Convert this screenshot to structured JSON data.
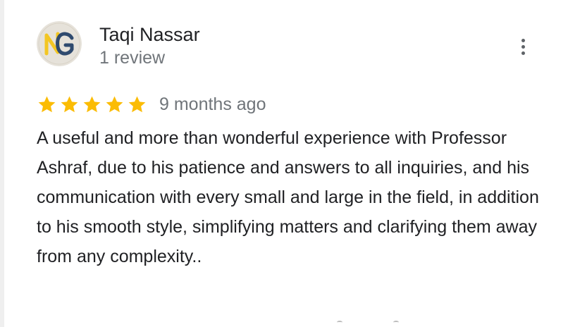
{
  "review": {
    "reviewer_name": "Taqi Nassar",
    "review_count": "1 review",
    "avatar_initials": "NG",
    "rating": 5,
    "rating_max": 5,
    "timestamp": "9 months ago",
    "text": "A useful and more than wonderful experience with Professor Ashraf, due to his patience and answers to all inquiries, and his communication with every small and large in the field, in addition to his smooth style, simplifying matters and clarifying them away from any complexity.."
  },
  "icons": {
    "more_options": "more-vert-icon",
    "star": "star-icon"
  },
  "colors": {
    "star": "#fbbc04",
    "name_text": "#202124",
    "secondary_text": "#70757a",
    "avatar_bg": "#e6e2da",
    "avatar_navy": "#2f4a6e",
    "avatar_gold": "#f3c623"
  }
}
